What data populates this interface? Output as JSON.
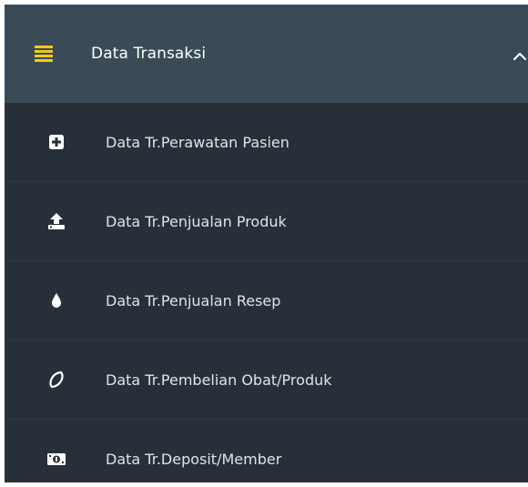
{
  "menu": {
    "header": {
      "title": "Data Transaksi",
      "icon": "hamburger-icon",
      "toggle_icon": "chevron-up-icon",
      "accent_color": "#f2c919",
      "background": "#3a4b57"
    },
    "background": "#273038",
    "items": [
      {
        "label": "Data Tr.Perawatan Pasien",
        "icon": "plus-square-icon"
      },
      {
        "label": "Data Tr.Penjualan Produk",
        "icon": "upload-icon"
      },
      {
        "label": "Data Tr.Penjualan Resep",
        "icon": "droplet-icon"
      },
      {
        "label": "Data Tr.Pembelian Obat/Produk",
        "icon": "leaf-icon"
      },
      {
        "label": "Data Tr.Deposit/Member",
        "icon": "money-icon"
      }
    ]
  }
}
